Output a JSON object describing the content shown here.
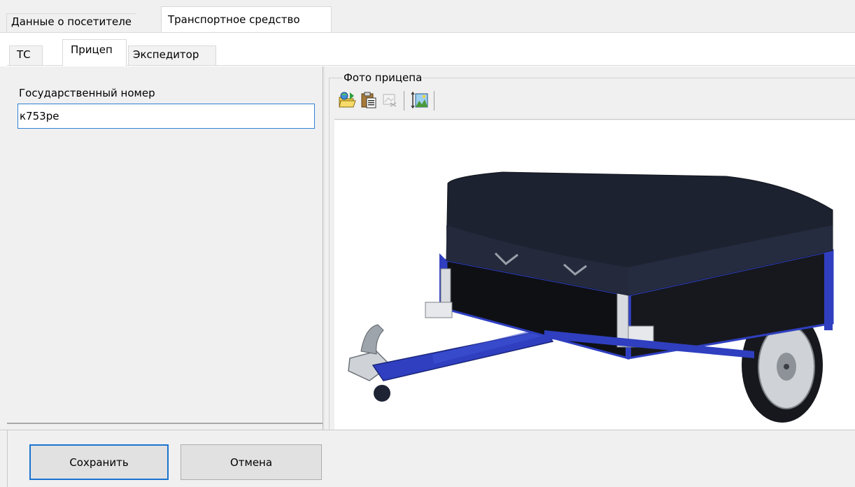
{
  "tabs_top": [
    {
      "label": "Данные о посетителе",
      "active": false
    },
    {
      "label": "Транспортное средство",
      "active": true
    }
  ],
  "tabs_sub": [
    {
      "label": "ТС",
      "active": false
    },
    {
      "label": "Прицеп",
      "active": true
    },
    {
      "label": "Экспедитор",
      "active": false
    }
  ],
  "form": {
    "plate_label": "Государственный номер",
    "plate_value": "к753ре"
  },
  "photo": {
    "group_label": "Фото прицепа",
    "toolbar_icons": [
      "open-file-icon",
      "paste-icon",
      "clear-image-icon",
      "fit-image-icon"
    ]
  },
  "buttons": {
    "save": "Сохранить",
    "cancel": "Отмена"
  },
  "colors": {
    "focus_border": "#2f82d3",
    "default_button_border": "#1a74d1",
    "trailer_frame": "#2f3fc0",
    "tarp": "#1d2231"
  }
}
